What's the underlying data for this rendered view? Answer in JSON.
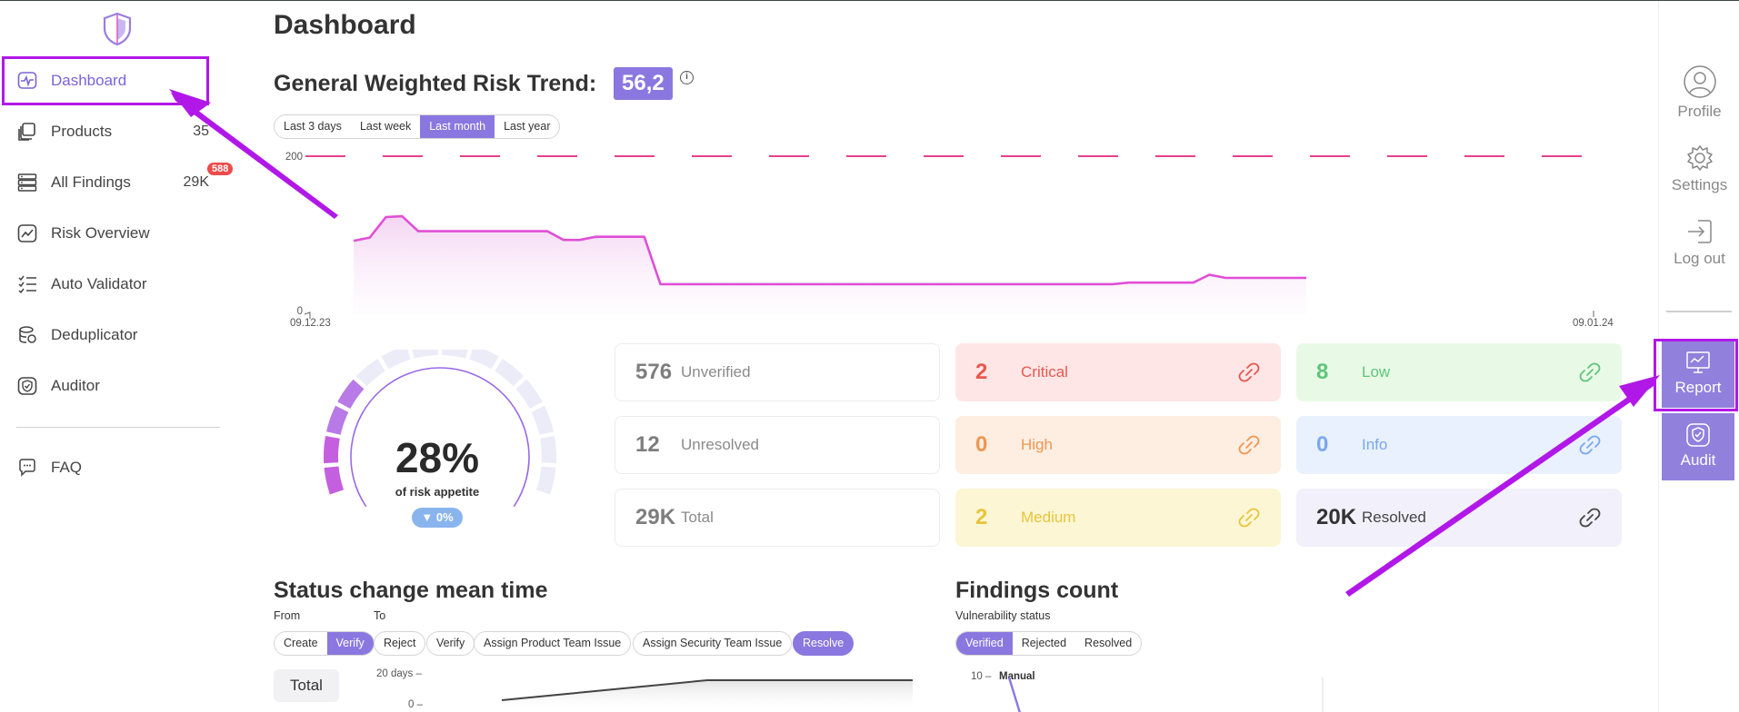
{
  "sidebar": {
    "items": [
      {
        "label": "Dashboard",
        "count": "",
        "icon": "pulse-monitor-icon"
      },
      {
        "label": "Products",
        "count": "35",
        "icon": "stack-icon"
      },
      {
        "label": "All Findings",
        "count": "29K",
        "icon": "server-list-icon"
      },
      {
        "label": "Risk Overview",
        "count": "",
        "icon": "trend-chart-icon"
      },
      {
        "label": "Auto Validator",
        "count": "",
        "icon": "checklist-icon"
      },
      {
        "label": "Deduplicator",
        "count": "",
        "icon": "layers-icon"
      },
      {
        "label": "Auditor",
        "count": "",
        "icon": "shield-check-icon"
      },
      {
        "label": "FAQ",
        "count": "",
        "icon": "chat-help-icon"
      }
    ],
    "findings_badge": "588"
  },
  "right_nav": {
    "profile": "Profile",
    "settings": "Settings",
    "logout": "Log out",
    "report": "Report",
    "audit": "Audit"
  },
  "page": {
    "title": "Dashboard",
    "risk_trend_title": "General Weighted Risk Trend:",
    "risk_score": "56,2",
    "info_symbol": "i"
  },
  "trend_ranges": [
    {
      "label": "Last 3 days",
      "active": false
    },
    {
      "label": "Last week",
      "active": false
    },
    {
      "label": "Last month",
      "active": true
    },
    {
      "label": "Last year",
      "active": false
    }
  ],
  "chart_data": {
    "type": "area",
    "y_ticks": [
      "200",
      "0"
    ],
    "x_start_label": "09.12.23",
    "x_end_label": "09.01.24",
    "ylim": [
      0,
      200
    ],
    "threshold": 200,
    "values": [
      93,
      97,
      123,
      124,
      105,
      105,
      105,
      105,
      105,
      105,
      105,
      105,
      105,
      94,
      94,
      98,
      98,
      98,
      98,
      38,
      38,
      38,
      38,
      38,
      38,
      38,
      38,
      38,
      38,
      38,
      38,
      38,
      38,
      38,
      38,
      38,
      38,
      38,
      38,
      38,
      38,
      38,
      38,
      38,
      38,
      38,
      38,
      38,
      40,
      40,
      40,
      40,
      40,
      50,
      46,
      46,
      46,
      46,
      46,
      46
    ]
  },
  "gauge": {
    "value_label": "28%",
    "value": 0.28,
    "sub_label": "of risk appetite",
    "delta": "▼ 0%"
  },
  "cards": {
    "unverified": {
      "num": "576",
      "label": "Unverified"
    },
    "unresolved": {
      "num": "12",
      "label": "Unresolved"
    },
    "total": {
      "num": "29K",
      "label": "Total"
    },
    "critical": {
      "num": "2",
      "label": "Critical"
    },
    "high": {
      "num": "0",
      "label": "High"
    },
    "medium": {
      "num": "2",
      "label": "Medium"
    },
    "low": {
      "num": "8",
      "label": "Low"
    },
    "info": {
      "num": "0",
      "label": "Info"
    },
    "resolved": {
      "num": "20K",
      "label": "Resolved"
    }
  },
  "colors": {
    "accent": "#8a78e0",
    "critical": "#e8574f",
    "high": "#f09653",
    "medium": "#e7c43b",
    "low": "#5fc47a",
    "info": "#7ba7ee",
    "trend_line": "#e04fd6",
    "threshold": "#e8418c",
    "annotation": "#b118e8"
  },
  "status_change": {
    "title": "Status change mean time",
    "from_label": "From",
    "to_label": "To",
    "from_options": [
      {
        "label": "Create",
        "active": false
      },
      {
        "label": "Verify",
        "active": true
      }
    ],
    "to_options": [
      {
        "label": "Reject",
        "active": false
      },
      {
        "label": "Verify",
        "active": false
      },
      {
        "label": "Assign Product Team Issue",
        "active": false
      },
      {
        "label": "Assign Security Team Issue",
        "active": false
      },
      {
        "label": "Resolve",
        "active": true
      }
    ],
    "total_label": "Total",
    "y_ticks": [
      "20 days –",
      "0 –"
    ]
  },
  "findings_count": {
    "title": "Findings count",
    "subtitle": "Vulnerability status",
    "tabs": [
      {
        "label": "Verified",
        "active": true
      },
      {
        "label": "Rejected",
        "active": false
      },
      {
        "label": "Resolved",
        "active": false
      }
    ],
    "y_tick": "10 –",
    "series_label": "Manual"
  }
}
